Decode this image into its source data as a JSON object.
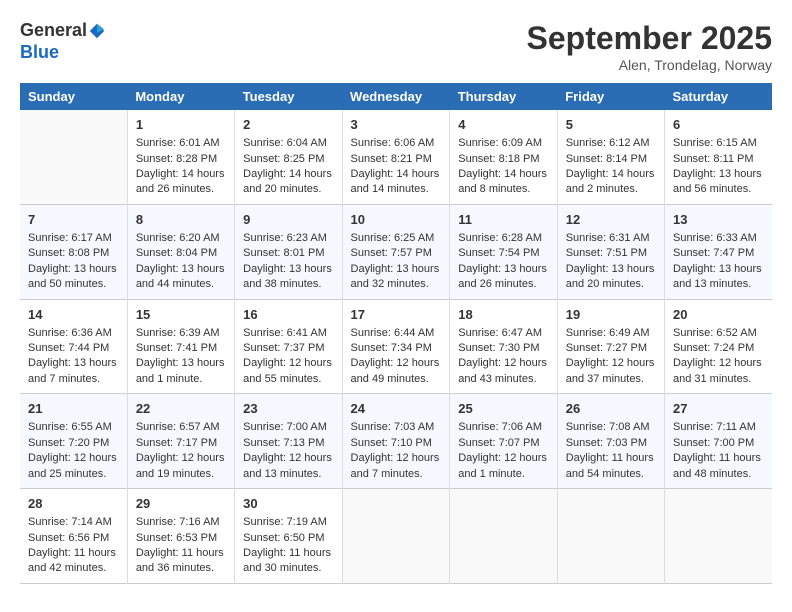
{
  "header": {
    "logo_line1": "General",
    "logo_line2": "Blue",
    "month_title": "September 2025",
    "location": "Alen, Trondelag, Norway"
  },
  "columns": [
    "Sunday",
    "Monday",
    "Tuesday",
    "Wednesday",
    "Thursday",
    "Friday",
    "Saturday"
  ],
  "weeks": [
    [
      {
        "day": "",
        "sunrise": "",
        "sunset": "",
        "daylight": ""
      },
      {
        "day": "1",
        "sunrise": "Sunrise: 6:01 AM",
        "sunset": "Sunset: 8:28 PM",
        "daylight": "Daylight: 14 hours and 26 minutes."
      },
      {
        "day": "2",
        "sunrise": "Sunrise: 6:04 AM",
        "sunset": "Sunset: 8:25 PM",
        "daylight": "Daylight: 14 hours and 20 minutes."
      },
      {
        "day": "3",
        "sunrise": "Sunrise: 6:06 AM",
        "sunset": "Sunset: 8:21 PM",
        "daylight": "Daylight: 14 hours and 14 minutes."
      },
      {
        "day": "4",
        "sunrise": "Sunrise: 6:09 AM",
        "sunset": "Sunset: 8:18 PM",
        "daylight": "Daylight: 14 hours and 8 minutes."
      },
      {
        "day": "5",
        "sunrise": "Sunrise: 6:12 AM",
        "sunset": "Sunset: 8:14 PM",
        "daylight": "Daylight: 14 hours and 2 minutes."
      },
      {
        "day": "6",
        "sunrise": "Sunrise: 6:15 AM",
        "sunset": "Sunset: 8:11 PM",
        "daylight": "Daylight: 13 hours and 56 minutes."
      }
    ],
    [
      {
        "day": "7",
        "sunrise": "Sunrise: 6:17 AM",
        "sunset": "Sunset: 8:08 PM",
        "daylight": "Daylight: 13 hours and 50 minutes."
      },
      {
        "day": "8",
        "sunrise": "Sunrise: 6:20 AM",
        "sunset": "Sunset: 8:04 PM",
        "daylight": "Daylight: 13 hours and 44 minutes."
      },
      {
        "day": "9",
        "sunrise": "Sunrise: 6:23 AM",
        "sunset": "Sunset: 8:01 PM",
        "daylight": "Daylight: 13 hours and 38 minutes."
      },
      {
        "day": "10",
        "sunrise": "Sunrise: 6:25 AM",
        "sunset": "Sunset: 7:57 PM",
        "daylight": "Daylight: 13 hours and 32 minutes."
      },
      {
        "day": "11",
        "sunrise": "Sunrise: 6:28 AM",
        "sunset": "Sunset: 7:54 PM",
        "daylight": "Daylight: 13 hours and 26 minutes."
      },
      {
        "day": "12",
        "sunrise": "Sunrise: 6:31 AM",
        "sunset": "Sunset: 7:51 PM",
        "daylight": "Daylight: 13 hours and 20 minutes."
      },
      {
        "day": "13",
        "sunrise": "Sunrise: 6:33 AM",
        "sunset": "Sunset: 7:47 PM",
        "daylight": "Daylight: 13 hours and 13 minutes."
      }
    ],
    [
      {
        "day": "14",
        "sunrise": "Sunrise: 6:36 AM",
        "sunset": "Sunset: 7:44 PM",
        "daylight": "Daylight: 13 hours and 7 minutes."
      },
      {
        "day": "15",
        "sunrise": "Sunrise: 6:39 AM",
        "sunset": "Sunset: 7:41 PM",
        "daylight": "Daylight: 13 hours and 1 minute."
      },
      {
        "day": "16",
        "sunrise": "Sunrise: 6:41 AM",
        "sunset": "Sunset: 7:37 PM",
        "daylight": "Daylight: 12 hours and 55 minutes."
      },
      {
        "day": "17",
        "sunrise": "Sunrise: 6:44 AM",
        "sunset": "Sunset: 7:34 PM",
        "daylight": "Daylight: 12 hours and 49 minutes."
      },
      {
        "day": "18",
        "sunrise": "Sunrise: 6:47 AM",
        "sunset": "Sunset: 7:30 PM",
        "daylight": "Daylight: 12 hours and 43 minutes."
      },
      {
        "day": "19",
        "sunrise": "Sunrise: 6:49 AM",
        "sunset": "Sunset: 7:27 PM",
        "daylight": "Daylight: 12 hours and 37 minutes."
      },
      {
        "day": "20",
        "sunrise": "Sunrise: 6:52 AM",
        "sunset": "Sunset: 7:24 PM",
        "daylight": "Daylight: 12 hours and 31 minutes."
      }
    ],
    [
      {
        "day": "21",
        "sunrise": "Sunrise: 6:55 AM",
        "sunset": "Sunset: 7:20 PM",
        "daylight": "Daylight: 12 hours and 25 minutes."
      },
      {
        "day": "22",
        "sunrise": "Sunrise: 6:57 AM",
        "sunset": "Sunset: 7:17 PM",
        "daylight": "Daylight: 12 hours and 19 minutes."
      },
      {
        "day": "23",
        "sunrise": "Sunrise: 7:00 AM",
        "sunset": "Sunset: 7:13 PM",
        "daylight": "Daylight: 12 hours and 13 minutes."
      },
      {
        "day": "24",
        "sunrise": "Sunrise: 7:03 AM",
        "sunset": "Sunset: 7:10 PM",
        "daylight": "Daylight: 12 hours and 7 minutes."
      },
      {
        "day": "25",
        "sunrise": "Sunrise: 7:06 AM",
        "sunset": "Sunset: 7:07 PM",
        "daylight": "Daylight: 12 hours and 1 minute."
      },
      {
        "day": "26",
        "sunrise": "Sunrise: 7:08 AM",
        "sunset": "Sunset: 7:03 PM",
        "daylight": "Daylight: 11 hours and 54 minutes."
      },
      {
        "day": "27",
        "sunrise": "Sunrise: 7:11 AM",
        "sunset": "Sunset: 7:00 PM",
        "daylight": "Daylight: 11 hours and 48 minutes."
      }
    ],
    [
      {
        "day": "28",
        "sunrise": "Sunrise: 7:14 AM",
        "sunset": "Sunset: 6:56 PM",
        "daylight": "Daylight: 11 hours and 42 minutes."
      },
      {
        "day": "29",
        "sunrise": "Sunrise: 7:16 AM",
        "sunset": "Sunset: 6:53 PM",
        "daylight": "Daylight: 11 hours and 36 minutes."
      },
      {
        "day": "30",
        "sunrise": "Sunrise: 7:19 AM",
        "sunset": "Sunset: 6:50 PM",
        "daylight": "Daylight: 11 hours and 30 minutes."
      },
      {
        "day": "",
        "sunrise": "",
        "sunset": "",
        "daylight": ""
      },
      {
        "day": "",
        "sunrise": "",
        "sunset": "",
        "daylight": ""
      },
      {
        "day": "",
        "sunrise": "",
        "sunset": "",
        "daylight": ""
      },
      {
        "day": "",
        "sunrise": "",
        "sunset": "",
        "daylight": ""
      }
    ]
  ]
}
